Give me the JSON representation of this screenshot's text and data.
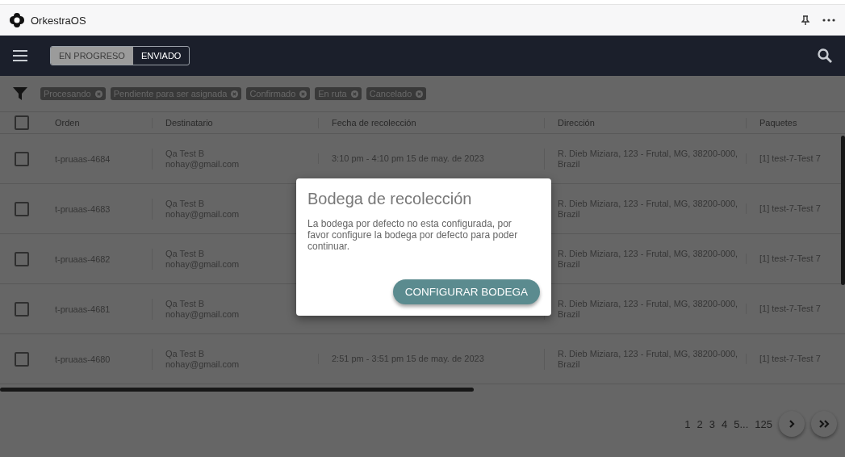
{
  "app": {
    "title": "OrkestraOS"
  },
  "tabs": [
    {
      "label": "EN PROGRESO",
      "selected": true
    },
    {
      "label": "ENVIADO",
      "selected": false
    }
  ],
  "filters": [
    "Procesando",
    "Pendiente para ser asignada",
    "Confirmado",
    "En ruta",
    "Cancelado"
  ],
  "table": {
    "all_checked": false,
    "columns": [
      "Orden",
      "Destinatario",
      "Fecha de recolección",
      "Dirección",
      "Paquetes"
    ],
    "rows": [
      {
        "checked": false,
        "order": "t-pruaas-4684",
        "name": "Qa Test B",
        "email": "nohay@gmail.com",
        "date": "3:10 pm - 4:10 pm 15 de may. de 2023",
        "address": "R. Dieb Miziara, 123 - Frutal, MG, 38200-000, Brazil",
        "packages": "[1] test-7-Test 7"
      },
      {
        "checked": false,
        "order": "t-pruaas-4683",
        "name": "Qa Test B",
        "email": "nohay@gmail.com",
        "address": "R. Dieb Miziara, 123 - Frutal, MG, 38200-000, Brazil",
        "packages": "[1] test-7-Test 7"
      },
      {
        "checked": false,
        "order": "t-pruaas-4682",
        "name": "Qa Test B",
        "email": "nohay@gmail.com",
        "address": "R. Dieb Miziara, 123 - Frutal, MG, 38200-000, Brazil",
        "packages": "[1] test-7-Test 7"
      },
      {
        "checked": false,
        "order": "t-pruaas-4681",
        "name": "Qa Test B",
        "email": "nohay@gmail.com",
        "address": "R. Dieb Miziara, 123 - Frutal, MG, 38200-000, Brazil",
        "packages": "[1] test-7-Test 7"
      },
      {
        "checked": false,
        "order": "t-pruaas-4680",
        "name": "Qa Test B",
        "email": "nohay@gmail.com",
        "date": "2:51 pm - 3:51 pm 15 de may. de 2023",
        "address": "R. Dieb Miziara, 123 - Frutal, MG, 38200-000, Brazil",
        "packages": "[1] test-7-Test 7"
      }
    ]
  },
  "pagination": {
    "pages": [
      "1",
      "2",
      "3",
      "4",
      "5...",
      "125"
    ]
  },
  "dialog": {
    "title": "Bodega de recolección",
    "message": "La bodega por defecto no esta configurada, por favor configure la bodega por defecto para poder continuar.",
    "button": "CONFIGURAR BODEGA"
  }
}
